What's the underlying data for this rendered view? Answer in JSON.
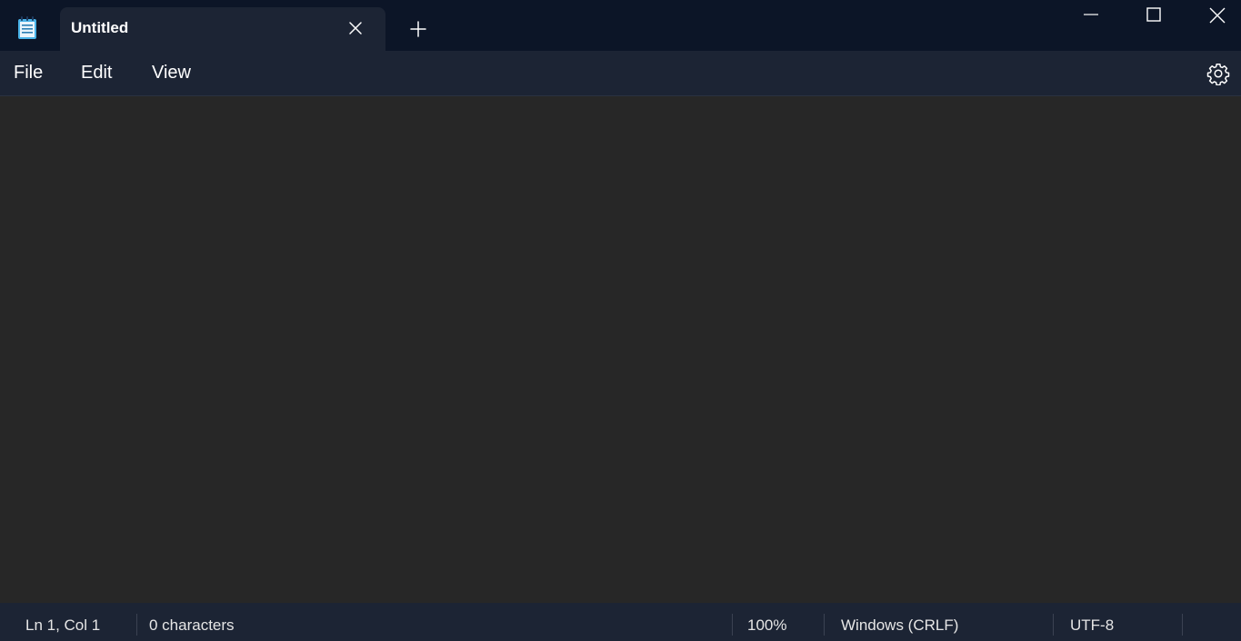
{
  "tab": {
    "title": "Untitled"
  },
  "menu": {
    "file": "File",
    "edit": "Edit",
    "view": "View"
  },
  "icons": {
    "app": "notepad-icon",
    "tab_close": "close-icon",
    "new_tab": "plus-icon",
    "minimize": "minimize-icon",
    "maximize": "maximize-icon",
    "close": "close-icon",
    "settings": "gear-icon"
  },
  "editor": {
    "value": ""
  },
  "status": {
    "position": "Ln 1, Col 1",
    "characters": "0 characters",
    "zoom": "100%",
    "line_ending": "Windows (CRLF)",
    "encoding": "UTF-8"
  },
  "colors": {
    "titlebar": "#0c1527",
    "tab": "#1c2434",
    "editor_bg": "#272727"
  }
}
